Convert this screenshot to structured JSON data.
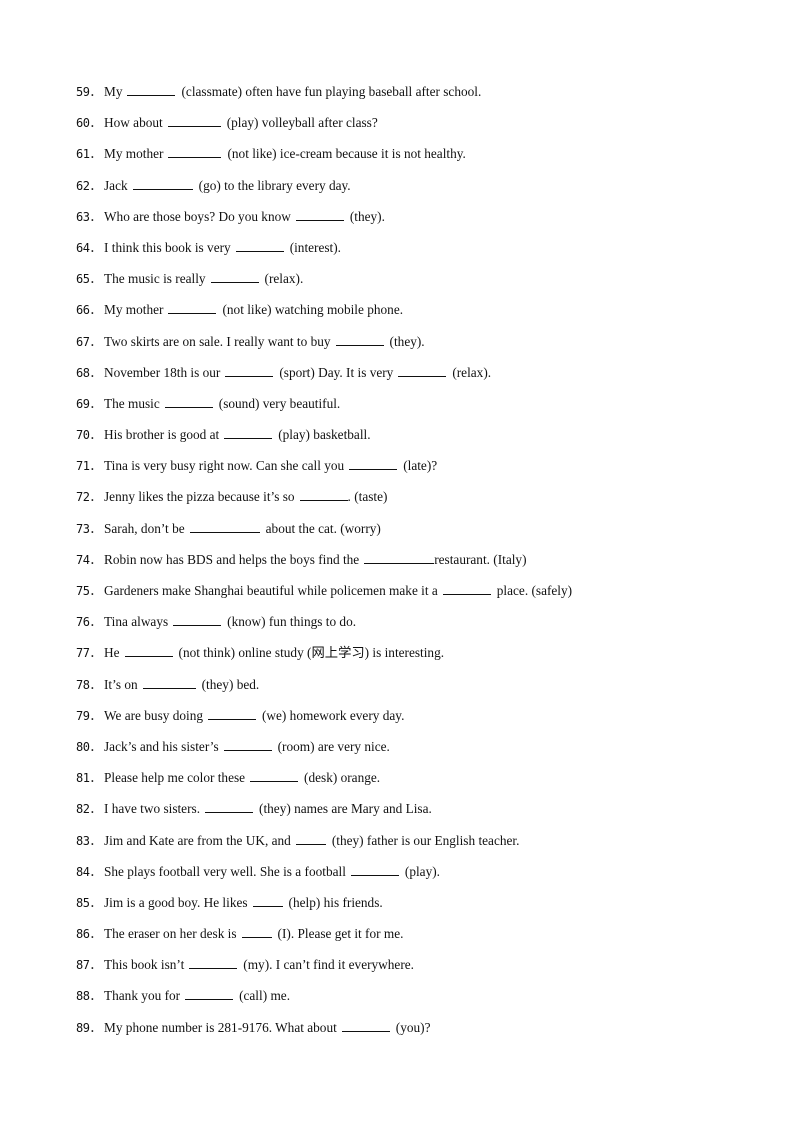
{
  "questions": [
    {
      "num": "59．",
      "pre": "My",
      "blank": "w7",
      "post": "(classmate) often have fun playing baseball after school."
    },
    {
      "num": "60．",
      "pre": "How about",
      "blank": "w8",
      "post": "(play) volleyball after class?"
    },
    {
      "num": "61．",
      "pre": "My mother",
      "blank": "w8",
      "post": "(not like) ice-cream because it is not healthy."
    },
    {
      "num": "62．",
      "pre": "Jack",
      "blank": "w9",
      "post": "(go) to the library every day."
    },
    {
      "num": "63．",
      "pre": "Who are those boys? Do you know",
      "blank": "w7",
      "post": "(they)."
    },
    {
      "num": "64．",
      "pre": "I think this book is very",
      "blank": "w7",
      "post": "(interest)."
    },
    {
      "num": "65．",
      "pre": "The music is really",
      "blank": "w7",
      "post": "(relax)."
    },
    {
      "num": "66．",
      "pre": "My mother",
      "blank": "w7",
      "post": "(not like) watching mobile phone."
    },
    {
      "num": "67．",
      "pre": "Two skirts are on sale. I really want to buy",
      "blank": "w7",
      "post": "(they)."
    },
    {
      "num": "68．",
      "pre": "November 18th is our",
      "blank": "w7",
      "mid": "(sport) Day. It is very",
      "blank2": "w7",
      "post": "(relax)."
    },
    {
      "num": "69．",
      "pre": "The music",
      "blank": "w7",
      "post": "(sound) very beautiful."
    },
    {
      "num": "70．",
      "pre": "His brother is good at",
      "blank": "w7",
      "post": "(play) basketball."
    },
    {
      "num": "71．",
      "pre": "Tina is very busy right now. Can she call you",
      "blank": "w7",
      "post": "(late)?"
    },
    {
      "num": "72．",
      "pre": "Jenny likes the pizza because it’s so",
      "blank": "w7",
      "post": ". (taste)",
      "tight": true
    },
    {
      "num": "73．",
      "pre": "Sarah, don’t be",
      "blank": "w10",
      "post": "about the cat. (worry)"
    },
    {
      "num": "74．",
      "pre": "Robin now has BDS and helps the boys find the",
      "blank": "w10",
      "post": "restaurant. (Italy)",
      "tight": true
    },
    {
      "num": "75．",
      "pre": "Gardeners make Shanghai beautiful while policemen make it a",
      "blank": "w7",
      "post": "place. (safely)"
    },
    {
      "num": "76．",
      "pre": "Tina always",
      "blank": "w7",
      "post": "(know) fun things to do."
    },
    {
      "num": "77．",
      "pre": "He",
      "blank": "w7",
      "post": "(not think) online study (网上学习) is interesting."
    },
    {
      "num": "78．",
      "pre": "It’s on",
      "blank": "w8",
      "post": "(they) bed."
    },
    {
      "num": "79．",
      "pre": "We are busy doing",
      "blank": "w7",
      "post": "(we) homework every day."
    },
    {
      "num": "80．",
      "pre": "Jack’s and his sister’s",
      "blank": "w7",
      "post": "(room) are very nice."
    },
    {
      "num": "81．",
      "pre": "Please help me color these",
      "blank": "w7",
      "post": "(desk) orange."
    },
    {
      "num": "82．",
      "pre": "I have two sisters.",
      "blank": "w7",
      "post": "(they) names are Mary and Lisa."
    },
    {
      "num": "83．",
      "pre": "Jim and Kate are from the UK, and",
      "blank": "w4",
      "post": "(they) father is our English teacher."
    },
    {
      "num": "84．",
      "pre": "She plays football very well. She is a football",
      "blank": "w7",
      "post": "(play)."
    },
    {
      "num": "85．",
      "pre": "Jim is a good boy. He likes",
      "blank": "w4",
      "post": "(help) his friends."
    },
    {
      "num": "86．",
      "pre": "The eraser on her desk is",
      "blank": "w4",
      "post": "(I). Please get it for me."
    },
    {
      "num": "87．",
      "pre": "This book isn’t",
      "blank": "w7",
      "post": "(my). I can’t find it everywhere."
    },
    {
      "num": "88．",
      "pre": "Thank you for",
      "blank": "w7",
      "post": "(call) me."
    },
    {
      "num": "89．",
      "pre": "My phone number is 281-9176. What about",
      "blank": "w7",
      "post": "(you)?"
    }
  ]
}
